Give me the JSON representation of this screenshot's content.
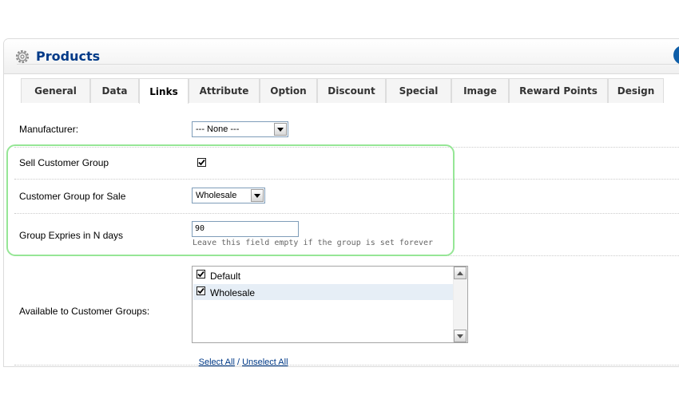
{
  "heading": {
    "title": "Products",
    "icon": "gear-icon",
    "accent_color": "#003a88"
  },
  "tabs": [
    {
      "label": "General",
      "active": false
    },
    {
      "label": "Data",
      "active": false
    },
    {
      "label": "Links",
      "active": true
    },
    {
      "label": "Attribute",
      "active": false
    },
    {
      "label": "Option",
      "active": false
    },
    {
      "label": "Discount",
      "active": false
    },
    {
      "label": "Special",
      "active": false
    },
    {
      "label": "Image",
      "active": false
    },
    {
      "label": "Reward Points",
      "active": false
    },
    {
      "label": "Design",
      "active": false
    }
  ],
  "form": {
    "manufacturer": {
      "label": "Manufacturer:",
      "value": "--- None ---"
    },
    "sell_customer_group": {
      "label": "Sell Customer Group",
      "checked": true
    },
    "customer_group_for_sale": {
      "label": "Customer Group for Sale",
      "value": "Wholesale"
    },
    "group_expires": {
      "label": "Group Expries in N days",
      "value": "90",
      "help": "Leave this field empty if the group is set forever"
    },
    "available_groups": {
      "label": "Available to Customer Groups:",
      "options": [
        {
          "label": "Default",
          "checked": true
        },
        {
          "label": "Wholesale",
          "checked": true
        }
      ],
      "select_all": "Select All",
      "separator": " / ",
      "unselect_all": "Unselect All"
    }
  },
  "colors": {
    "highlight_border": "#96e696",
    "link": "#003a88",
    "selected_row": "#e6eef6"
  }
}
